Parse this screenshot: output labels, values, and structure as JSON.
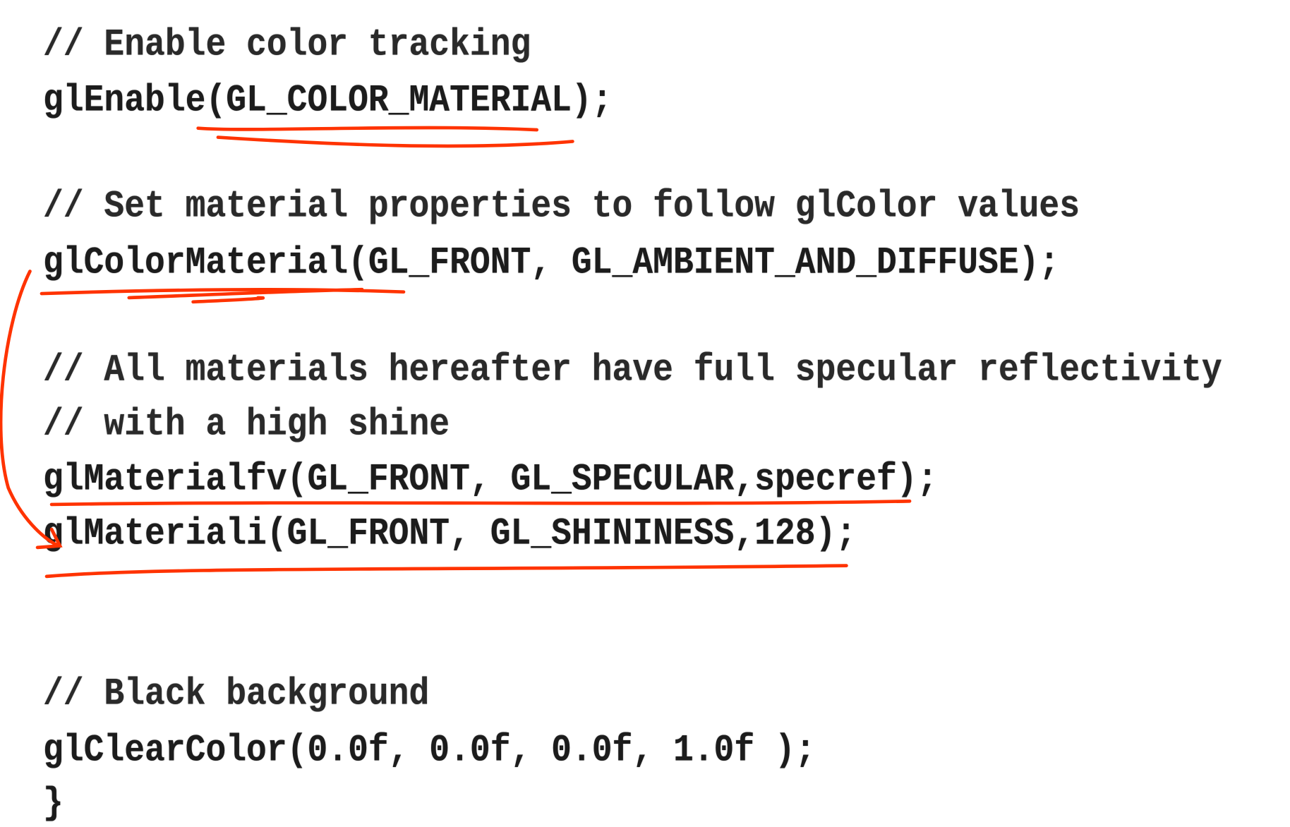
{
  "code_lines": [
    "// Enable color tracking",
    "glEnable(GL_COLOR_MATERIAL);",
    "// Set material properties to follow glColor values",
    "glColorMaterial(GL_FRONT, GL_AMBIENT_AND_DIFFUSE);",
    "// All materials hereafter have full specular reflectivity",
    "// with a high shine",
    "glMaterialfv(GL_FRONT, GL_SPECULAR,specref);",
    "glMateriali(GL_FRONT, GL_SHININESS,128);",
    "// Black background",
    "glClearColor(0.0f, 0.0f, 0.0f, 1.0f );",
    "}"
  ],
  "annotation_color": "#ff3300"
}
